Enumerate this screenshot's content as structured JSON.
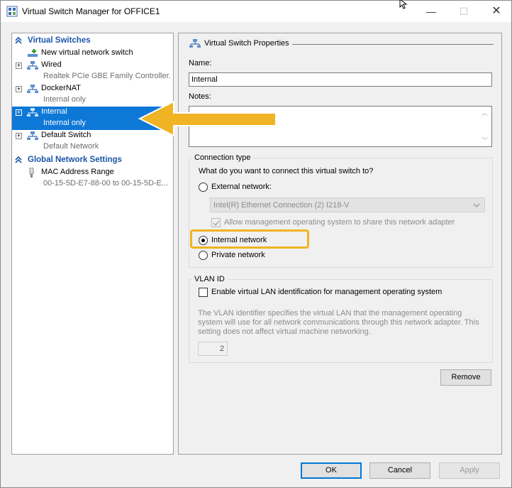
{
  "window": {
    "title": "Virtual Switch Manager for OFFICE1"
  },
  "sidebar": {
    "virtual_switches_header": "Virtual Switches",
    "items": [
      {
        "name": "New virtual network switch",
        "sub": ""
      },
      {
        "name": "Wired",
        "sub": "Realtek PCIe GBE Family Controller..."
      },
      {
        "name": "DockerNAT",
        "sub": "Internal only"
      },
      {
        "name": "Internal",
        "sub": "Internal only",
        "selected": true
      },
      {
        "name": "Default Switch",
        "sub": "Default Network"
      }
    ],
    "global_header": "Global Network Settings",
    "global_items": [
      {
        "name": "MAC Address Range",
        "sub": "00-15-5D-E7-88-00 to 00-15-5D-E..."
      }
    ]
  },
  "properties": {
    "section_title": "Virtual Switch Properties",
    "name_label": "Name:",
    "name_value": "Internal",
    "notes_label": "Notes:",
    "notes_value": "",
    "connection_type": {
      "title": "Connection type",
      "question": "What do you want to connect this virtual switch to?",
      "external_label": "External network:",
      "adapter_selected": "Intel(R) Ethernet Connection (2) I218-V",
      "allow_mgmt_label": "Allow management operating system to share this network adapter",
      "internal_label": "Internal network",
      "private_label": "Private network",
      "selected": "internal"
    },
    "vlan": {
      "title": "VLAN ID",
      "enable_label": "Enable virtual LAN identification for management operating system",
      "description": "The VLAN identifier specifies the virtual LAN that the management operating system will use for all network communications through this network adapter. This setting does not affect virtual machine networking.",
      "value": "2"
    },
    "remove_label": "Remove"
  },
  "footer": {
    "ok_label": "OK",
    "cancel_label": "Cancel",
    "apply_label": "Apply"
  },
  "annotations": {
    "highlight_color": "#f0b323",
    "arrow_color": "#f0b323"
  },
  "colors": {
    "selection": "#0e78d7",
    "section_header": "#1a56a8"
  }
}
